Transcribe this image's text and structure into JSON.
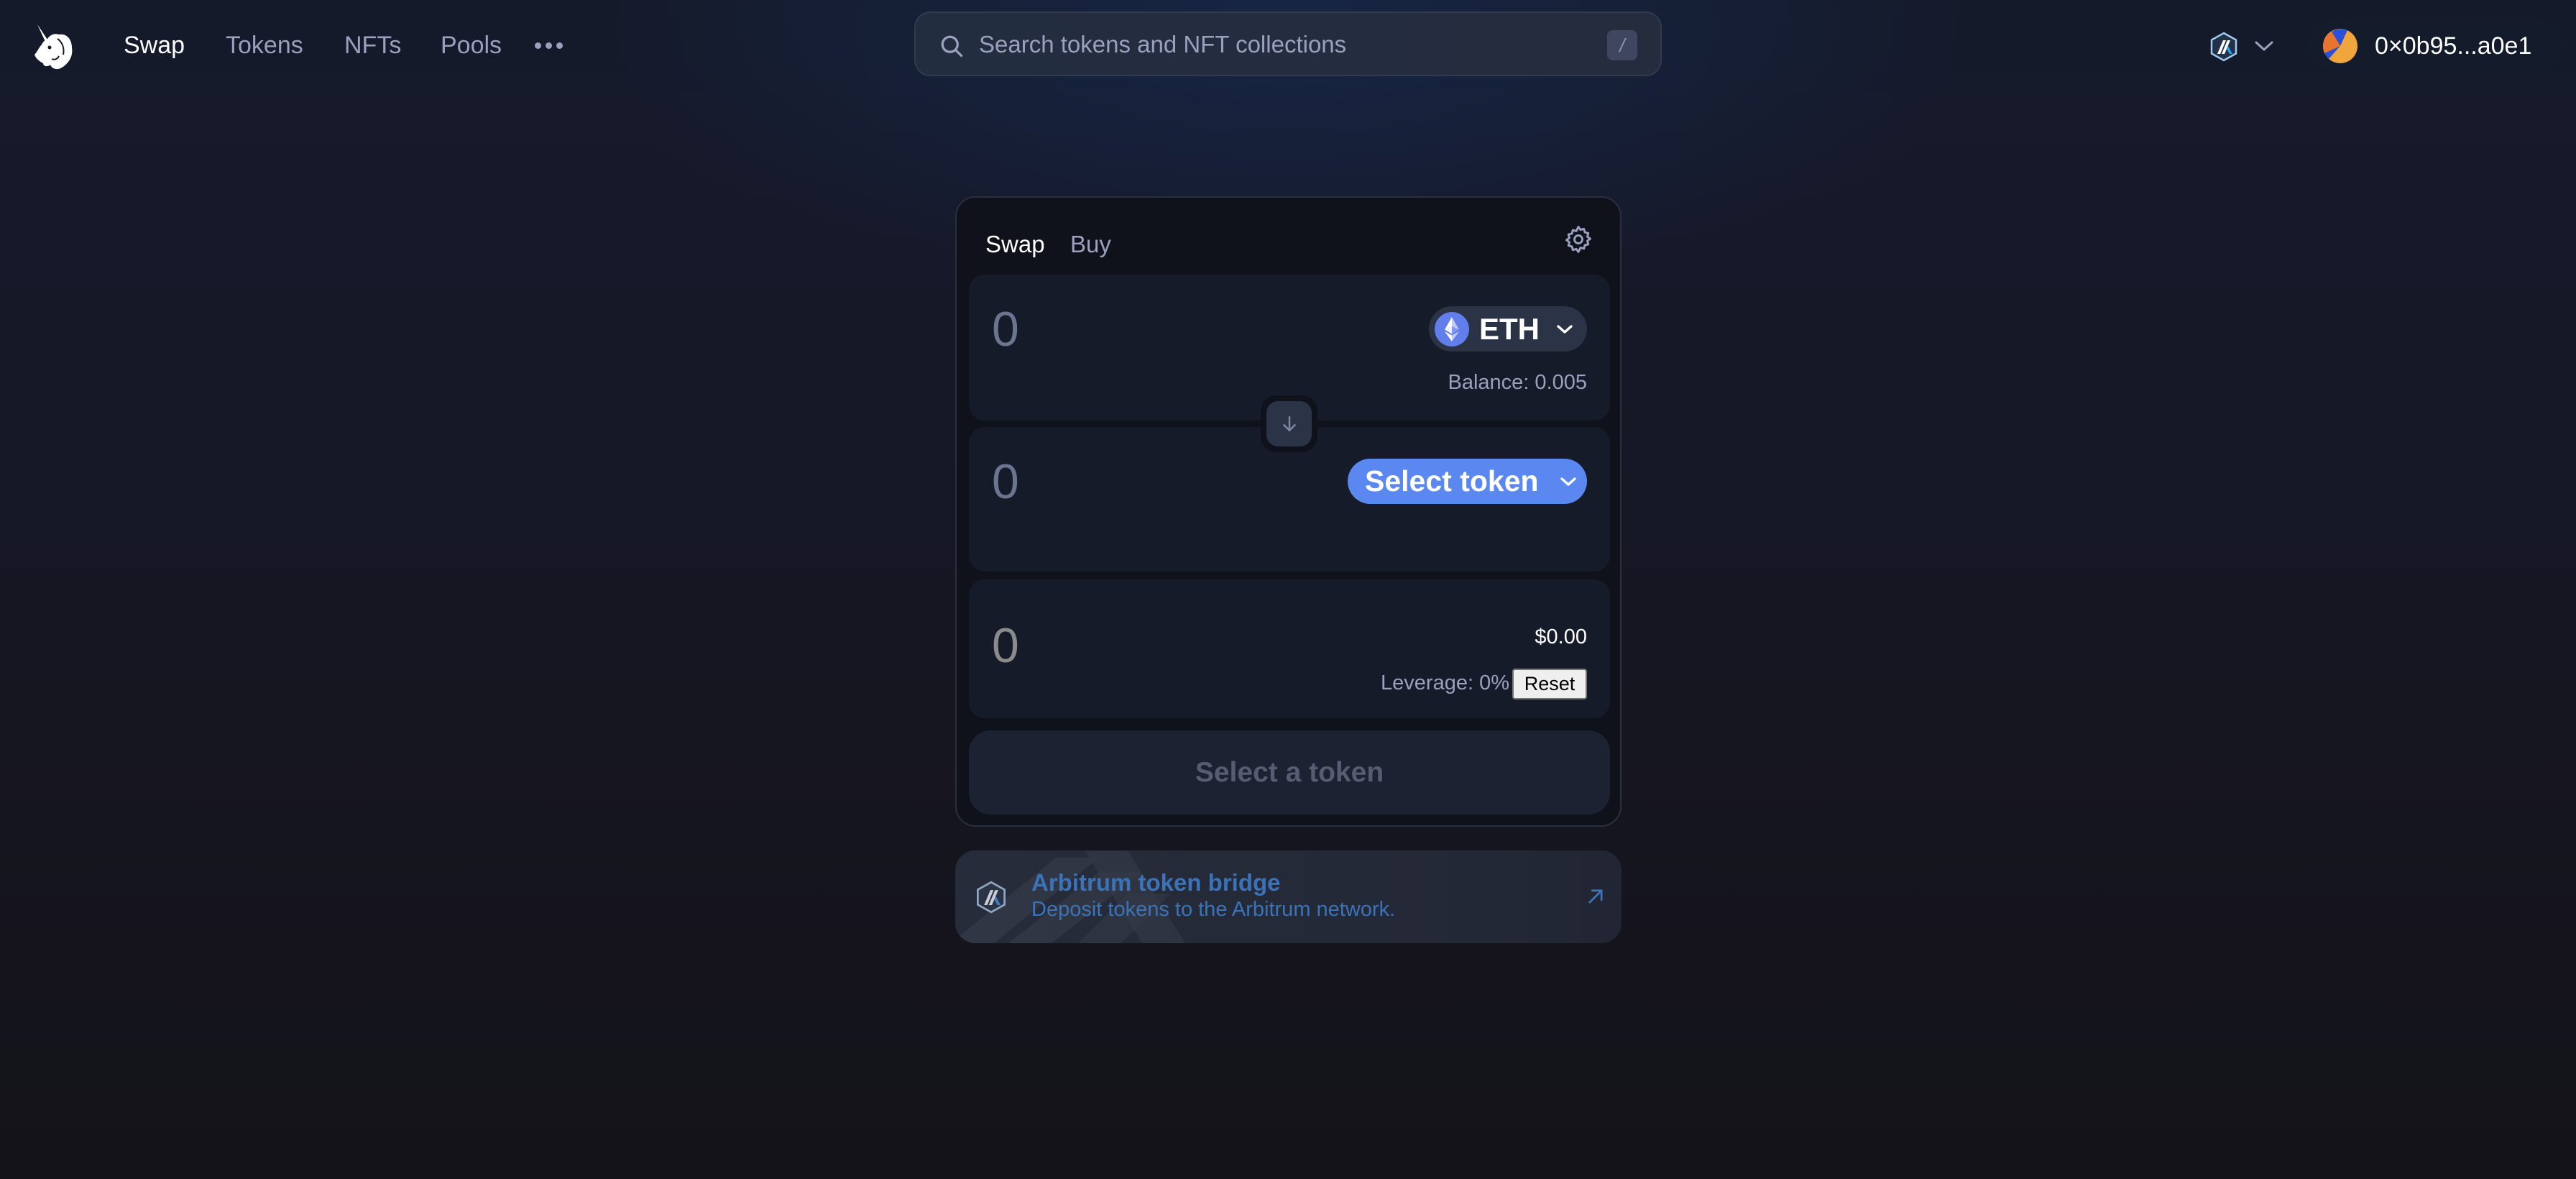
{
  "header": {
    "logo_icon": "uniswap-unicorn-icon",
    "nav": [
      {
        "label": "Swap",
        "active": true
      },
      {
        "label": "Tokens",
        "active": false
      },
      {
        "label": "NFTs",
        "active": false
      },
      {
        "label": "Pools",
        "active": false
      }
    ],
    "more_icon": "ellipsis-icon",
    "search": {
      "placeholder": "Search tokens and NFT collections",
      "value": "",
      "shortcut_key": "/"
    },
    "network": {
      "name": "Arbitrum",
      "icon": "arbitrum-icon"
    },
    "wallet": {
      "address": "0×0b95...a0e1",
      "avatar_icon": "wallet-avatar-icon"
    }
  },
  "swap_card": {
    "tabs": [
      {
        "label": "Swap",
        "active": true
      },
      {
        "label": "Buy",
        "active": false
      }
    ],
    "settings_icon": "gear-icon",
    "input_panel": {
      "amount_placeholder": "0",
      "amount_value": "",
      "token_symbol": "ETH",
      "balance": "Balance: 0.005"
    },
    "switch_icon": "arrow-down-icon",
    "output_panel": {
      "amount_placeholder": "0",
      "amount_value": "",
      "select_label": "Select token"
    },
    "leverage_panel": {
      "amount_placeholder": "0",
      "amount_value": "",
      "usd_value": "$0.00",
      "leverage_label": "Leverage: 0%",
      "reset_label": "Reset"
    },
    "submit_label": "Select a token"
  },
  "bridge_banner": {
    "title": "Arbitrum token bridge",
    "subtitle": "Deposit tokens to the Arbitrum network.",
    "link_icon": "external-arrow-icon"
  },
  "colors": {
    "accent": "#5a87f0",
    "bridge_text": "#3b73b8",
    "muted_text": "#9aa0bd"
  }
}
